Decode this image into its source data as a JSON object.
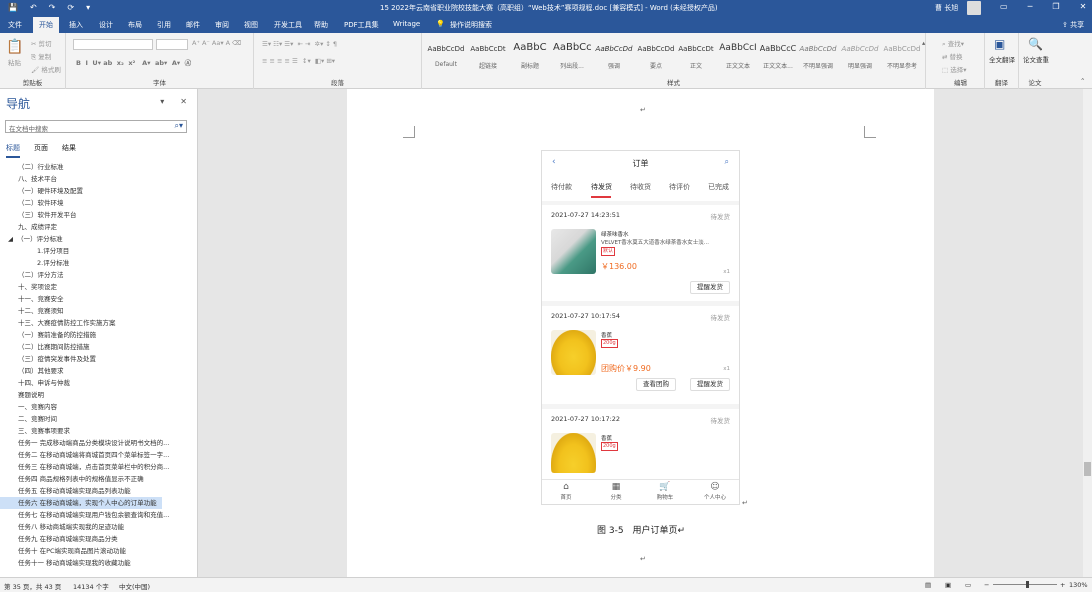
{
  "window": {
    "title": "15 2022年云南省职业院校技能大赛（高职组）“Web技术”赛项规程.doc [兼容模式] - Word (未经授权产品)",
    "user": "曹 长旭",
    "share": "共享"
  },
  "quick_access": [
    "💾",
    "↶",
    "↷",
    "⟳",
    "▾"
  ],
  "ribbon_tabs": [
    "文件",
    "开始",
    "插入",
    "设计",
    "布局",
    "引用",
    "邮件",
    "审阅",
    "视图",
    "开发工具",
    "帮助",
    "PDF工具集",
    "Writage",
    "操作说明搜索"
  ],
  "active_tab": "开始",
  "ribbon": {
    "clipboard": {
      "paste": "粘贴",
      "cut": "剪切",
      "copy": "复制",
      "format_painter": "格式刷",
      "label": "剪贴板"
    },
    "font": {
      "label": "字体"
    },
    "paragraph": {
      "label": "段落"
    },
    "styles": {
      "label": "样式",
      "items": [
        {
          "preview": "AaBbCcDd",
          "name": "Default"
        },
        {
          "preview": "AaBbCcDt",
          "name": "超链接"
        },
        {
          "preview": "AaBbC",
          "name": "副标题"
        },
        {
          "preview": "AaBbCc",
          "name": "列出段..."
        },
        {
          "preview": "AaBbCcDd",
          "name": "强调"
        },
        {
          "preview": "AaBbCcDd",
          "name": "要点"
        },
        {
          "preview": "AaBbCcDt",
          "name": "正文"
        },
        {
          "preview": "AaBbCcI",
          "name": "正文文本"
        },
        {
          "preview": "AaBbCcC",
          "name": "正文文本..."
        },
        {
          "preview": "AaBbCcDd",
          "name": "不明显强调"
        },
        {
          "preview": "AaBbCcDd",
          "name": "明显强调"
        },
        {
          "preview": "AaBbCcDd",
          "name": "不明显参考"
        }
      ]
    },
    "editing": {
      "find": "查找",
      "replace": "替换",
      "select": "选择",
      "label": "编辑"
    },
    "translate": {
      "btn": "全文翻译",
      "label": "翻译"
    },
    "paper": {
      "btn": "论文查重",
      "label": "论文"
    }
  },
  "nav": {
    "title": "导航",
    "search_placeholder": "在文档中搜索",
    "tabs": [
      "标题",
      "页面",
      "结果"
    ],
    "items": [
      "（二）行业标准",
      "八、技术平台",
      "（一）硬件环境及配置",
      "（二）软件环境",
      "（三）软件开发平台",
      "九、成绩评定",
      "（一）评分标准",
      "1.评分项目",
      "2.评分标准",
      "（二）评分方法",
      "十、奖项设定",
      "十一、竞赛安全",
      "十二、竞赛须知",
      "十三、大赛疫情防控工作实施方案",
      "（一）赛前准备的防控措施",
      "（二）比赛期间防控措施",
      "（三）疫情突发事件及处置",
      "（四）其他要求",
      "十四、申诉与仲裁",
      "赛题说明",
      "一、竞赛内容",
      "二、竞赛时间",
      "三、竞赛事项要求",
      "任务一 完成移动端商品分类模块设计说明书文档的...",
      "任务二 在移动商城端将商城首页四个菜单标签一字...",
      "任务三 在移动商城端，点击首页菜单栏中的积分商...",
      "任务四 商品规格列表中的规格值显示不正确",
      "任务五 在移动商城端实现商品列表功能",
      "任务六 在移动商城端，实现个人中心的订单功能",
      "任务七 在移动商城端实现用户钱包余额查询和充值...",
      "任务八 移动商城端实现我的足迹功能",
      "任务九 在移动商城端实现商品分类",
      "任务十 在PC端实现商品图片滚动功能",
      "任务十一 移动商城端实现我的收藏功能"
    ],
    "selected_index": 28
  },
  "phone": {
    "title": "订单",
    "back": "‹",
    "search": "⌕",
    "tabs": [
      "待付款",
      "待发货",
      "待收货",
      "待评价",
      "已完成"
    ],
    "active_tab": 1,
    "orders": [
      {
        "time": "2021-07-27 14:23:51",
        "status": "待发货",
        "product_name": "绿茶味香水",
        "product_desc": "VELVET香水莫五大道香水绿茶香水女士淡...",
        "tag": "默认",
        "price": "￥136.00",
        "qty": "x1",
        "buttons": [
          "提醒发货"
        ]
      },
      {
        "time": "2021-07-27 10:17:54",
        "status": "待发货",
        "product_name": "香蕉",
        "tag": "200g",
        "price": "团购价￥9.90",
        "qty": "x1",
        "buttons": [
          "查看团购",
          "提醒发货"
        ]
      },
      {
        "time": "2021-07-27 10:17:22",
        "status": "待发货",
        "product_name": "香蕉",
        "tag": "200g"
      }
    ],
    "bottom_nav": [
      {
        "icon": "⌂",
        "label": "首页"
      },
      {
        "icon": "▦",
        "label": "分类"
      },
      {
        "icon": "🛒",
        "label": "购物车"
      },
      {
        "icon": "☺",
        "label": "个人中心"
      }
    ]
  },
  "caption": "图 3-5　用户订单页↵",
  "status": {
    "page": "第 35 页，共 43 页",
    "words": "14134 个字",
    "lang": "中文(中国)",
    "zoom": "130%"
  }
}
